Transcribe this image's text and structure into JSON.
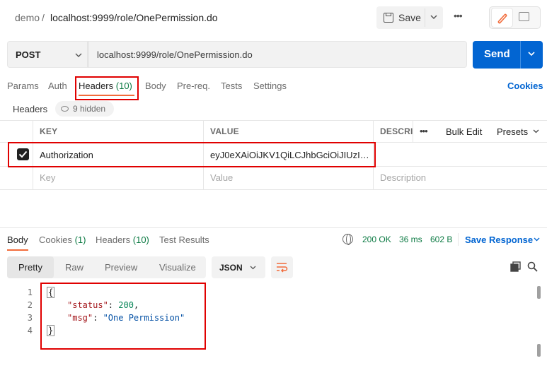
{
  "breadcrumb": {
    "workspace": "demo",
    "separator": "/",
    "request_name": "localhost:9999/role/OnePermission.do"
  },
  "toolbar": {
    "save_label": "Save",
    "more_label": "•••"
  },
  "request": {
    "method": "POST",
    "url": "localhost:9999/role/OnePermission.do",
    "send_label": "Send"
  },
  "request_tabs": {
    "params": "Params",
    "auth": "Auth",
    "headers": "Headers",
    "headers_count": "(10)",
    "body": "Body",
    "prereq": "Pre-req.",
    "tests": "Tests",
    "settings": "Settings",
    "cookies": "Cookies"
  },
  "headers_section": {
    "title": "Headers",
    "hidden_label": "9 hidden"
  },
  "headers_table": {
    "columns": {
      "key": "KEY",
      "value": "VALUE",
      "description": "DESCRI",
      "more": "•••",
      "bulk_edit": "Bulk Edit",
      "presets": "Presets"
    },
    "rows": [
      {
        "checked": true,
        "key": "Authorization",
        "value": "eyJ0eXAiOiJKV1QiLCJhbGciOiJIUzI1Ni..."
      }
    ],
    "placeholders": {
      "key": "Key",
      "value": "Value",
      "description": "Description"
    }
  },
  "response_tabs": {
    "body": "Body",
    "cookies": "Cookies",
    "cookies_count": "(1)",
    "headers": "Headers",
    "headers_count": "(10)",
    "test_results": "Test Results"
  },
  "response_status": {
    "status": "200 OK",
    "time": "36 ms",
    "size": "602 B",
    "save_response": "Save Response"
  },
  "format": {
    "options": [
      "Pretty",
      "Raw",
      "Preview",
      "Visualize"
    ],
    "selected": "Pretty",
    "language": "JSON"
  },
  "response_body": {
    "line_numbers": [
      "1",
      "2",
      "3",
      "4"
    ],
    "open_brace": "{",
    "close_brace": "}",
    "status_key": "\"status\"",
    "status_value": "200",
    "msg_key": "\"msg\"",
    "msg_value": "\"One Permission\""
  },
  "colors": {
    "accent": "#0265d2",
    "tab_active": "#f26b3a",
    "status_ok": "#0c7a43",
    "highlight": "#e00000"
  }
}
